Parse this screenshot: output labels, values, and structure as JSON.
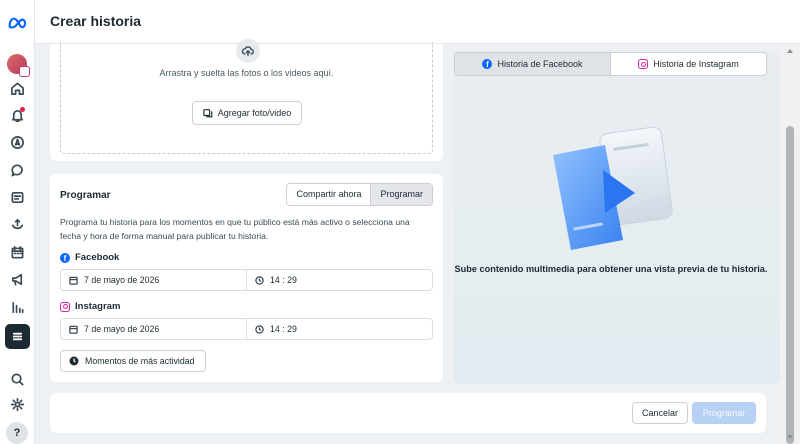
{
  "header": {
    "title": "Crear historia"
  },
  "sidebar": {
    "items": [
      {
        "icon": "meta-logo-icon"
      },
      {
        "icon": "avatar"
      },
      {
        "icon": "home-icon"
      },
      {
        "icon": "bell-icon"
      },
      {
        "icon": "compass-icon"
      },
      {
        "icon": "chat-icon"
      },
      {
        "icon": "content-icon"
      },
      {
        "icon": "planner-icon"
      },
      {
        "icon": "calendar-icon"
      },
      {
        "icon": "megaphone-icon"
      },
      {
        "icon": "insights-icon"
      },
      {
        "icon": "menu-icon"
      },
      {
        "icon": "search-icon"
      },
      {
        "icon": "gear-icon"
      }
    ],
    "help_label": "?"
  },
  "upload": {
    "drop_text": "Arrastra y suelta las fotos o los videos aquí.",
    "add_button": "Agregar foto/video"
  },
  "schedule": {
    "title": "Programar",
    "toggle": {
      "now": "Compartir ahora",
      "schedule": "Programar",
      "selected": "Programar"
    },
    "description": "Programa tu historia para los momentos en que tu público está más activo o selecciona una fecha y hora de forma manual para publicar tu historia.",
    "facebook": {
      "label": "Facebook",
      "date": "7 de mayo de 2026",
      "time": "14 : 29"
    },
    "instagram": {
      "label": "Instagram",
      "date": "7 de mayo de 2026",
      "time": "14 : 29"
    },
    "peak_button": "Momentos de más actividad"
  },
  "preview": {
    "tabs": [
      {
        "label": "Historia de Facebook",
        "active": true
      },
      {
        "label": "Historia de Instagram",
        "active": false
      }
    ],
    "caption": "Sube contenido multimedia para obtener una vista previa de tu historia."
  },
  "footer": {
    "cancel": "Cancelar",
    "submit": "Programar"
  },
  "colors": {
    "accent": "#0866ff",
    "disabled_primary": "#b7d1f5",
    "instagram": "#d6249f"
  }
}
